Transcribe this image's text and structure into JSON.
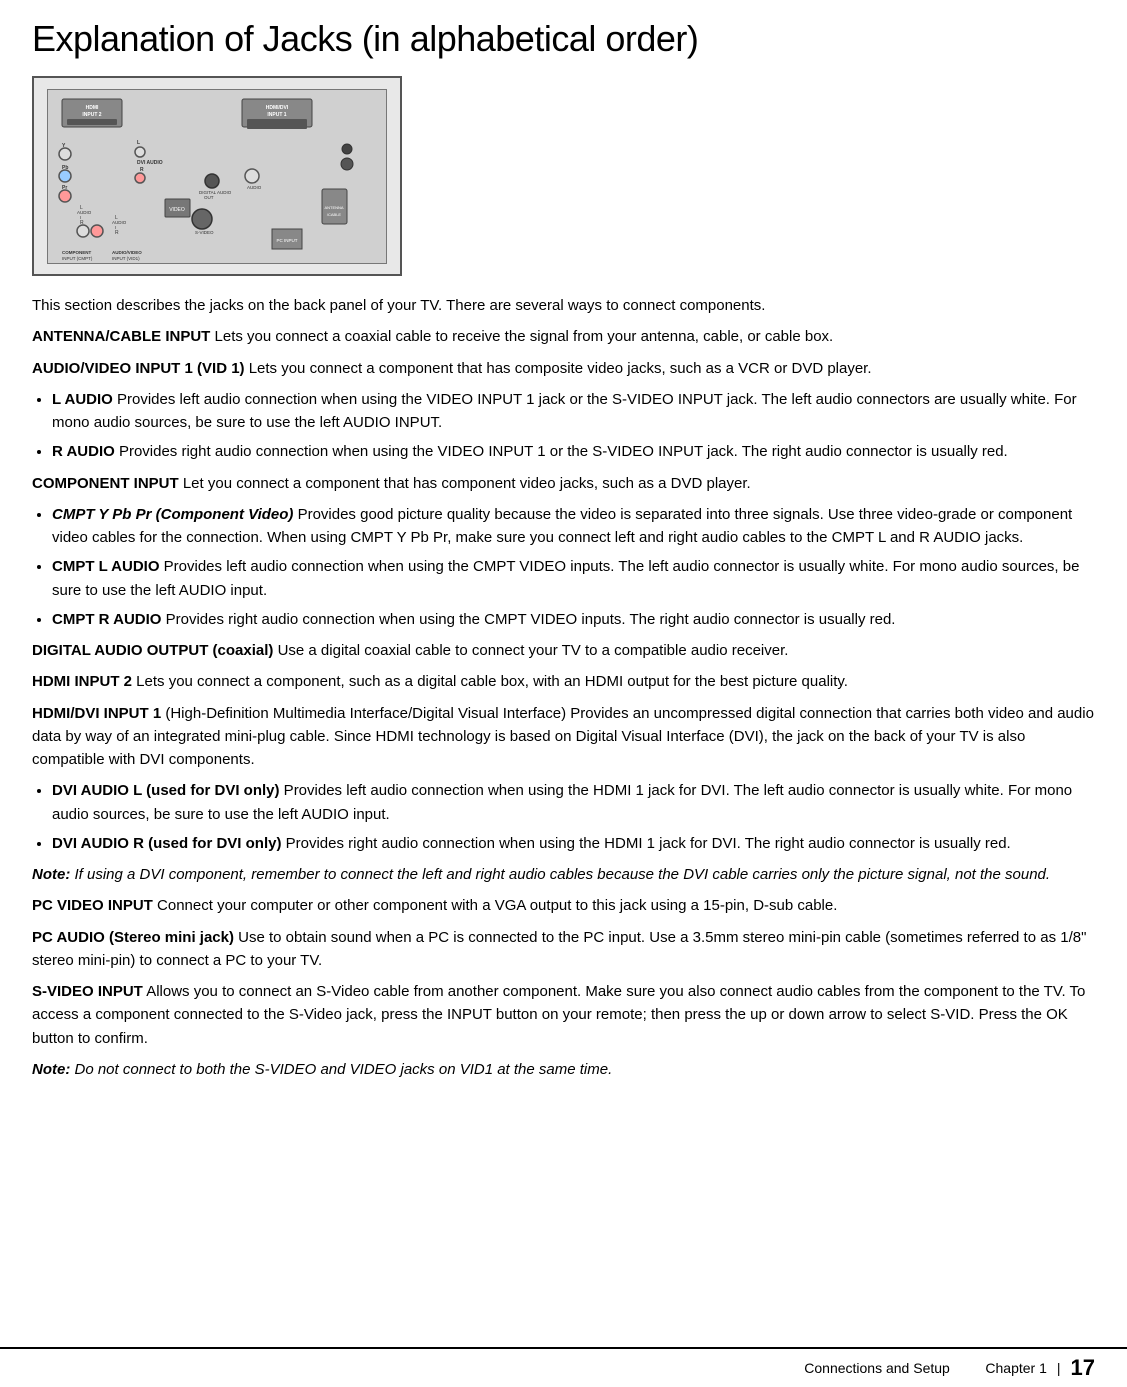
{
  "page": {
    "title": "Explanation of Jacks (in alphabetical order)"
  },
  "sections": [
    {
      "id": "intro",
      "text": "This section describes the jacks on the back panel of your TV. There are several ways to connect components."
    },
    {
      "id": "antenna",
      "label": "ANTENNA/CABLE INPUT",
      "text": " Lets you connect a coaxial cable to receive the signal from your antenna, cable, or cable box."
    },
    {
      "id": "audio_video",
      "label": "AUDIO/VIDEO INPUT 1 (VID 1)",
      "text": " Lets you connect a component that has composite video jacks, such as a VCR or DVD player."
    },
    {
      "id": "audio_video_bullets",
      "bullets": [
        {
          "label": "L AUDIO",
          "text": " Provides left audio connection when using the VIDEO INPUT 1 jack or the S-VIDEO INPUT jack. The left audio connectors are usually white. For mono audio sources, be sure to use the left AUDIO INPUT."
        },
        {
          "label": "R AUDIO",
          "text": " Provides right audio connection when using the VIDEO INPUT 1 or the S-VIDEO INPUT jack. The right audio connector is usually red."
        }
      ]
    },
    {
      "id": "component",
      "label": "COMPONENT INPUT",
      "text": " Let you connect a component that has component video jacks, such as a DVD player."
    },
    {
      "id": "component_bullets",
      "bullets": [
        {
          "label": "CMPT Y Pb Pr (Component Video)",
          "label_style": "italic-bold",
          "text": " Provides good picture quality because the video is separated into three signals. Use three video-grade or component video cables for the connection. When using CMPT Y Pb Pr, make sure you connect left and right audio cables to the CMPT L and R AUDIO jacks."
        },
        {
          "label": "CMPT L AUDIO",
          "text": " Provides left audio connection when using the  CMPT VIDEO inputs. The left audio connector is usually white. For mono audio sources, be sure to use the left AUDIO input."
        },
        {
          "label": "CMPT R AUDIO",
          "text": " Provides right audio connection when using the CMPT VIDEO inputs. The right audio connector is usually red."
        }
      ]
    },
    {
      "id": "digital_audio",
      "label": "DIGITAL AUDIO OUTPUT (coaxial)",
      "text": " Use a digital coaxial cable to connect your TV to a compatible audio receiver."
    },
    {
      "id": "hdmi2",
      "label": "HDMI INPUT 2",
      "text": "  Lets you connect a component, such as a digital cable box, with an HDMI output for the best picture quality."
    },
    {
      "id": "hdmi_dvi",
      "label": "HDMI/DVI INPUT 1",
      "text": " (High-Definition Multimedia Interface/Digital Visual Interface) Provides an uncompressed digital connection that carries both video and audio data by way of an integrated mini-plug cable. Since HDMI technology is based on Digital Visual Interface (DVI), the jack on the back of your TV is also compatible with DVI components."
    },
    {
      "id": "hdmi_dvi_bullets",
      "bullets": [
        {
          "label": "DVI AUDIO L (used for DVI only)",
          "text": " Provides left audio connection when using the HDMI 1 jack for DVI. The left audio connector is usually white. For mono audio sources, be sure to use the left AUDIO input."
        },
        {
          "label": "DVI AUDIO R (used for DVI only)",
          "text": " Provides right audio connection when using the HDMI 1 jack for DVI. The right audio connector is usually red."
        }
      ]
    },
    {
      "id": "dvi_note",
      "note_label": "Note:",
      "note_text": " If using a DVI component, remember to connect the left and right audio cables because the DVI cable carries only the picture signal, not the sound."
    },
    {
      "id": "pc_video",
      "label": "PC VIDEO INPUT",
      "text": "  Connect your computer or other component with a VGA output to this jack using a 15-pin, D-sub cable."
    },
    {
      "id": "pc_audio",
      "label": "PC AUDIO (Stereo mini jack)",
      "text": " Use to obtain sound when a PC is connected to the PC input. Use a 3.5mm stereo mini-pin cable (sometimes referred to as 1/8\" stereo mini-pin) to connect a PC to your TV."
    },
    {
      "id": "svideo",
      "label": "S-VIDEO INPUT",
      "text": "  Allows you to connect an S-Video cable from another component. Make sure you also connect audio cables from the component to the TV. To access a component connected to the S-Video jack, press the INPUT button on your remote; then press the up or down arrow to select S-VID. Press the OK button to confirm."
    },
    {
      "id": "svideo_note",
      "note_label": "Note:",
      "note_text": " Do not connect to both the S-VIDEO and VIDEO jacks on VID1 at the same time."
    }
  ],
  "footer": {
    "section_label": "Connections and Setup",
    "chapter_label": "Chapter 1",
    "page_number": "17"
  }
}
